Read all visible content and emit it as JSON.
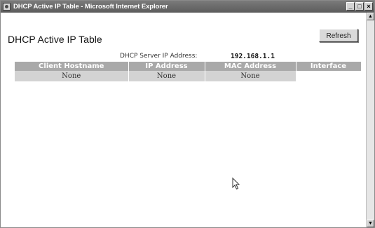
{
  "window": {
    "title": "DHCP Active IP Table - Microsoft Internet Explorer",
    "min_glyph": "_",
    "max_glyph": "□",
    "close_glyph": "×"
  },
  "page": {
    "title": "DHCP Active IP Table",
    "refresh_label": "Refresh",
    "server_label": "DHCP Server IP Address:",
    "server_ip": "192.168.1.1"
  },
  "table": {
    "headers": [
      "Client Hostname",
      "IP Address",
      "MAC Address",
      "Interface"
    ],
    "rows": [
      [
        "None",
        "None",
        "None",
        ""
      ]
    ]
  },
  "colors": {
    "header_bg": "#a9a9a9",
    "cell_bg": "#d3d3d3",
    "titlebar": "#6b6b6b"
  },
  "icons": [
    "app-icon",
    "minimize-icon",
    "maximize-icon",
    "close-icon",
    "scroll-up-icon",
    "scroll-down-icon",
    "mouse-cursor-icon"
  ]
}
